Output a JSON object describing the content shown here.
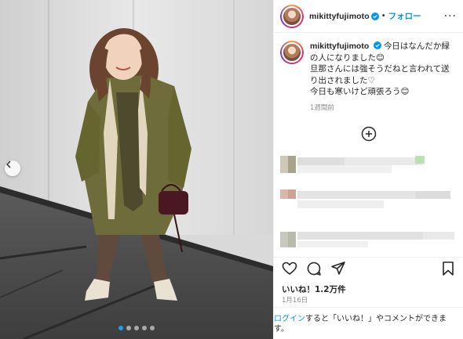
{
  "post": {
    "username": "mikittyfujimoto",
    "follow_label": "フォロー",
    "separator": "•",
    "more_label": "···",
    "caption_lines": [
      "今日はなんだか緑の人になりました😊",
      "旦那さんには強そうだねと言われて送り出されました♡",
      "今日も寒いけど頑張ろう😊"
    ],
    "caption_time": "1週間前",
    "likes": "いいね！1.2万件",
    "date": "1月16日",
    "login_link": "ログイン",
    "login_rest": "すると「いいね！」やコメントができます。"
  },
  "carousel": {
    "dot_count": 5,
    "active_dot": 0
  },
  "colors": {
    "link": "#0095f6",
    "jacket": "#6e6c3b",
    "bag": "#4a1822"
  }
}
